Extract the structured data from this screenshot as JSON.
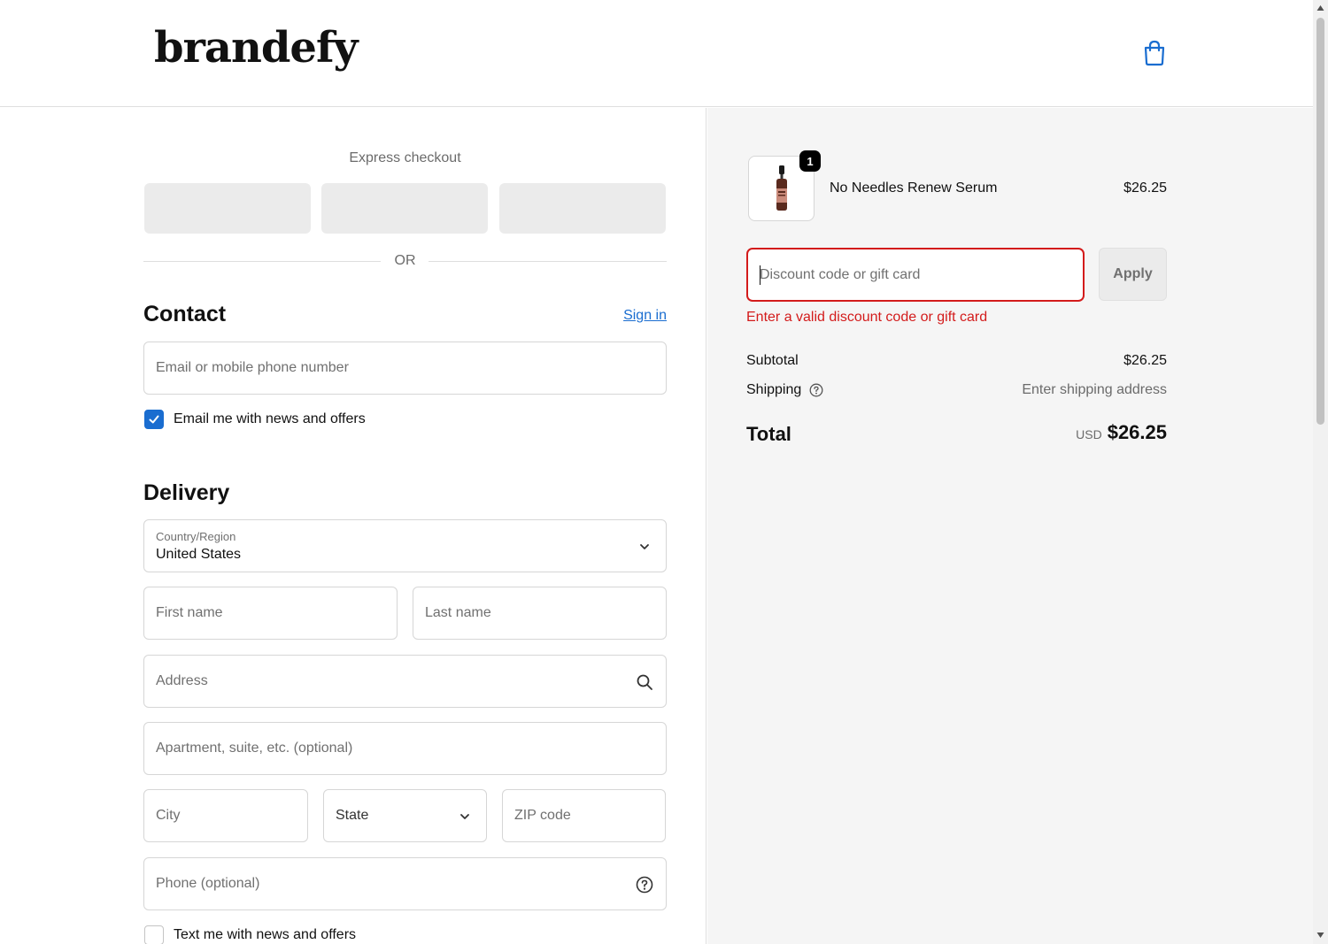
{
  "header": {
    "logo": "brandefy",
    "cart_icon": "shopping-bag-icon"
  },
  "express": {
    "title": "Express checkout",
    "or_text": "OR"
  },
  "contact": {
    "title": "Contact",
    "sign_in": "Sign in",
    "email_placeholder": "Email or mobile phone number",
    "newsletter_label": "Email me with news and offers",
    "newsletter_checked": true
  },
  "delivery": {
    "title": "Delivery",
    "country_label": "Country/Region",
    "country_value": "United States",
    "first_name": "First name",
    "last_name": "Last name",
    "address": "Address",
    "apartment": "Apartment, suite, etc. (optional)",
    "city": "City",
    "state": "State",
    "zip": "ZIP code",
    "phone": "Phone (optional)",
    "sms_label": "Text me with news and offers",
    "sms_checked": false
  },
  "order": {
    "item": {
      "name": "No Needles Renew Serum",
      "price": "$26.25",
      "quantity": "1"
    },
    "discount_placeholder": "Discount code or gift card",
    "apply_label": "Apply",
    "discount_error": "Enter a valid discount code or gift card",
    "subtotal_label": "Subtotal",
    "subtotal_value": "$26.25",
    "shipping_label": "Shipping",
    "shipping_value": "Enter shipping address",
    "total_label": "Total",
    "total_currency": "USD",
    "total_value": "$26.25"
  },
  "colors": {
    "accent": "#1a6dd0",
    "error": "#d31b1b",
    "summary_bg": "#f5f5f5"
  }
}
